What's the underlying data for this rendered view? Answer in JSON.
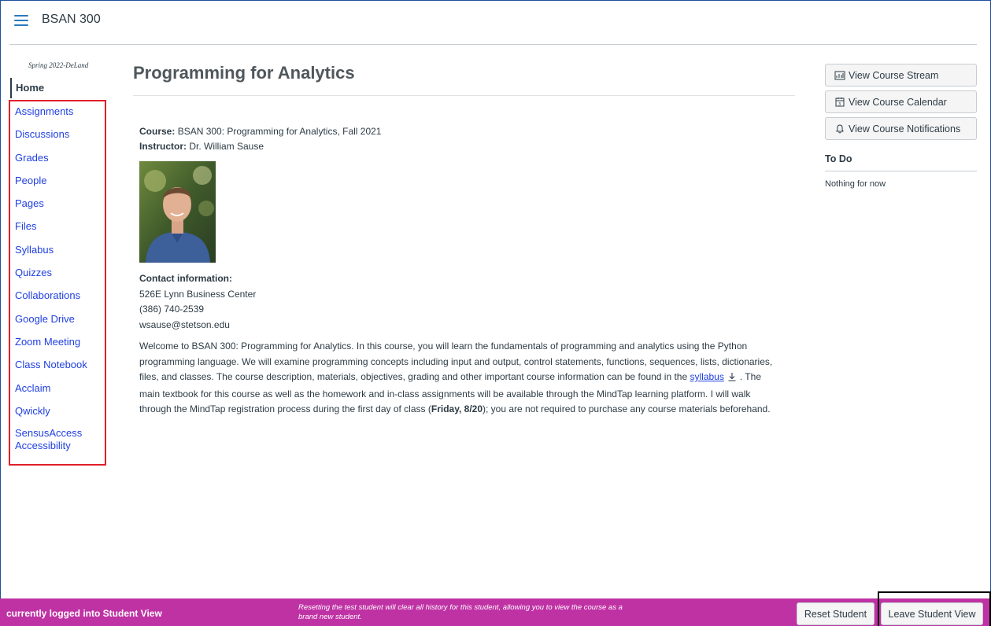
{
  "header": {
    "course_code": "BSAN 300"
  },
  "nav": {
    "term": "Spring 2022-DeLand",
    "home": "Home",
    "items": [
      "Assignments",
      "Discussions",
      "Grades",
      "People",
      "Pages",
      "Files",
      "Syllabus",
      "Quizzes",
      "Collaborations",
      "Google Drive",
      "Zoom Meeting",
      "Class Notebook",
      "Acclaim",
      "Qwickly",
      "SensusAccess Accessibility"
    ]
  },
  "main": {
    "title": "Programming for Analytics",
    "course_label": "Course:",
    "course_value": "BSAN 300: Programming for Analytics, Fall 2021",
    "instructor_label": "Instructor:",
    "instructor_value": "Dr. William Sause",
    "contact_heading": "Contact information:",
    "contact_lines": [
      "526E Lynn Business Center",
      "(386) 740-2539",
      "wsause@stetson.edu"
    ],
    "welcome_part1": "Welcome to BSAN 300: Programming for Analytics. In this course, you will learn the fundamentals of programming and analytics using the Python programming language.  We will examine programming concepts including input and output, control statements, functions, sequences, lists, dictionaries, files, and classes.  The course description, materials, objectives, grading and other important course information can be found in the ",
    "syllabus_link": "syllabus",
    "welcome_part2": ". The main textbook for this course as well as the homework and in-class assignments will be available through the MindTap learning platform. I will walk through the MindTap registration process during the first day of class (",
    "welcome_bold": "Friday, 8/20",
    "welcome_part3": "); you are not required to purchase any course materials beforehand."
  },
  "sidebar": {
    "stream": "View Course Stream",
    "calendar": "View Course Calendar",
    "notifications": "View Course Notifications",
    "todo_heading": "To Do",
    "todo_empty": "Nothing for now"
  },
  "student_view": {
    "status": "currently logged into Student View",
    "note": "Resetting the test student will clear all history for this student, allowing you to view the course as a brand new student.",
    "reset": "Reset Student",
    "leave": "Leave Student View"
  },
  "colors": {
    "link": "#1f3fe0",
    "student_bar": "#bf32a4",
    "highlight_box": "#e0202a"
  }
}
